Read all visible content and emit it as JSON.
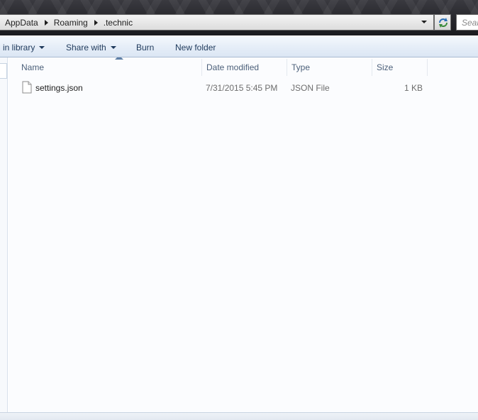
{
  "address": {
    "crumbs": [
      "AppData",
      "Roaming",
      ".technic"
    ]
  },
  "search": {
    "placeholder": "Search"
  },
  "toolbar": {
    "include_in_library": "in library",
    "share_with": "Share with",
    "burn": "Burn",
    "new_folder": "New folder"
  },
  "columns": {
    "name": "Name",
    "date_modified": "Date modified",
    "type": "Type",
    "size": "Size"
  },
  "files": [
    {
      "name": "settings.json",
      "date_modified": "7/31/2015 5:45 PM",
      "type": "JSON File",
      "size": "1 KB",
      "icon": "file-icon"
    }
  ],
  "colors": {
    "toolbar_text": "#1e395b",
    "header_text": "#4c607a",
    "detail_text": "#6d6d6d"
  }
}
